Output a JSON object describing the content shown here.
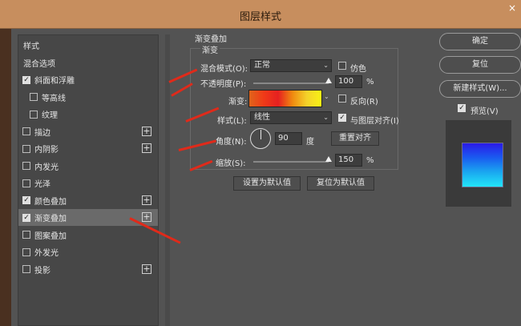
{
  "window": {
    "title": "图层样式",
    "close_glyph": "×"
  },
  "sidebar": {
    "items": [
      {
        "label": "样式",
        "checkbox": "none",
        "checked": false,
        "plus": false,
        "selected": false,
        "indent": false
      },
      {
        "label": "混合选项",
        "checkbox": "none",
        "checked": false,
        "plus": false,
        "selected": false,
        "indent": false
      },
      {
        "label": "斜面和浮雕",
        "checkbox": "box",
        "checked": true,
        "plus": false,
        "selected": false,
        "indent": false
      },
      {
        "label": "等高线",
        "checkbox": "box",
        "checked": false,
        "plus": false,
        "selected": false,
        "indent": true
      },
      {
        "label": "纹理",
        "checkbox": "box",
        "checked": false,
        "plus": false,
        "selected": false,
        "indent": true
      },
      {
        "label": "描边",
        "checkbox": "box",
        "checked": false,
        "plus": true,
        "selected": false,
        "indent": false
      },
      {
        "label": "内阴影",
        "checkbox": "box",
        "checked": false,
        "plus": true,
        "selected": false,
        "indent": false
      },
      {
        "label": "内发光",
        "checkbox": "box",
        "checked": false,
        "plus": false,
        "selected": false,
        "indent": false
      },
      {
        "label": "光泽",
        "checkbox": "box",
        "checked": false,
        "plus": false,
        "selected": false,
        "indent": false
      },
      {
        "label": "颜色叠加",
        "checkbox": "box",
        "checked": true,
        "plus": true,
        "selected": false,
        "indent": false
      },
      {
        "label": "渐变叠加",
        "checkbox": "box",
        "checked": true,
        "plus": true,
        "selected": true,
        "indent": false
      },
      {
        "label": "图案叠加",
        "checkbox": "box",
        "checked": false,
        "plus": false,
        "selected": false,
        "indent": false
      },
      {
        "label": "外发光",
        "checkbox": "box",
        "checked": false,
        "plus": false,
        "selected": false,
        "indent": false
      },
      {
        "label": "投影",
        "checkbox": "box",
        "checked": false,
        "plus": true,
        "selected": false,
        "indent": false
      }
    ],
    "plus_glyph": "+",
    "check_glyph": "✓"
  },
  "panel": {
    "section_title": "渐变叠加",
    "group_title": "渐变",
    "blend_mode_label": "混合模式(O):",
    "blend_mode_value": "正常",
    "dither_label": "仿色",
    "dither_checked": false,
    "opacity_label": "不透明度(P):",
    "opacity_value": "100",
    "opacity_level": 1.0,
    "percent": "%",
    "gradient_label": "渐变:",
    "reverse_label": "反向(R)",
    "reverse_checked": false,
    "style_label": "样式(L):",
    "style_value": "线性",
    "align_label": "与图层对齐(I)",
    "align_checked": true,
    "angle_label": "角度(N):",
    "angle_value": "90",
    "angle_unit": "度",
    "reset_align_button": "重置对齐",
    "scale_label": "缩放(S):",
    "scale_value": "150",
    "scale_level": 1.0,
    "set_default_button": "设置为默认值",
    "reset_default_button": "复位为默认值",
    "chevron_glyph": "⌄"
  },
  "right_buttons": {
    "ok": "确定",
    "reset": "复位",
    "new_style": "新建样式(W)...",
    "preview_label": "预览(V)",
    "preview_checked": true
  },
  "colors": {
    "annotation_arrow": "#e02a1a",
    "gradient_stops": [
      "#e0641a",
      "#f03a18",
      "#e62020",
      "#f08a10",
      "#f4d22a",
      "#f8f214"
    ],
    "preview_stops": [
      "#2a1ae8",
      "#1a5cf0",
      "#1aa8f0",
      "#22e6f8"
    ]
  }
}
